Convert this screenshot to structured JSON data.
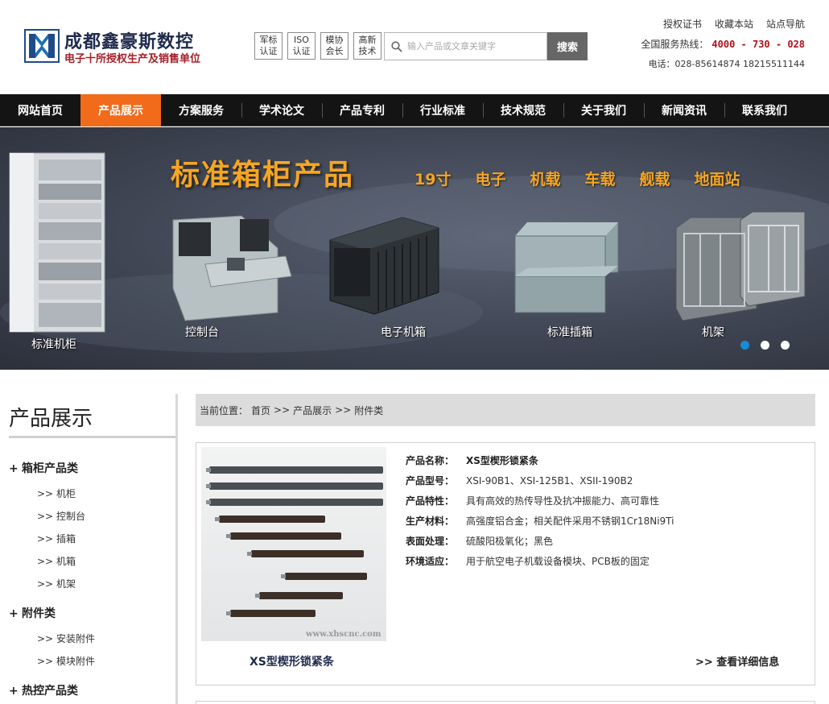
{
  "header": {
    "company_name": "成都鑫豪斯数控",
    "company_sub": "电子十所授权生产及销售单位",
    "badges": [
      {
        "line1": "军标",
        "line2": "认证"
      },
      {
        "line1": "ISO",
        "line2": "认证"
      },
      {
        "line1": "模协",
        "line2": "会长"
      },
      {
        "line1": "高新",
        "line2": "技术"
      }
    ],
    "search_placeholder": "输入产品或文章关键字",
    "search_button": "搜索",
    "top_links": [
      "授权证书",
      "收藏本站",
      "站点导航"
    ],
    "hotline_label": "全国服务热线：",
    "hotline_number": "4000 - 730 - 028",
    "phone": "电话：028-85614874 18215511144"
  },
  "nav": {
    "items": [
      "网站首页",
      "产品展示",
      "方案服务",
      "学术论文",
      "产品专利",
      "行业标准",
      "技术规范",
      "关于我们",
      "新闻资讯",
      "联系我们"
    ],
    "active_index": 1,
    "active_color": "#f26b1a"
  },
  "banner": {
    "title": "标准箱柜产品",
    "tags": [
      "19寸",
      "电子",
      "机载",
      "车载",
      "舰载",
      "地面站"
    ],
    "captions": [
      "标准机柜",
      "控制台",
      "电子机箱",
      "标准插箱",
      "机架"
    ],
    "slides": 3,
    "active_slide": 0,
    "title_color": "#f5a623"
  },
  "sidebar": {
    "title": "产品展示",
    "categories": [
      {
        "label": "箱柜产品类",
        "items": [
          "机柜",
          "控制台",
          "插箱",
          "机箱",
          "机架"
        ]
      },
      {
        "label": "附件类",
        "items": [
          "安装附件",
          "模块附件"
        ]
      },
      {
        "label": "热控产品类",
        "items": []
      }
    ]
  },
  "breadcrumb": {
    "label": "当前位置：",
    "path": [
      "首页",
      "产品展示",
      "附件类"
    ],
    "separator": ">>"
  },
  "product": {
    "caption": "XS型楔形锁紧条",
    "watermark": "www.xhscnc.com",
    "detail_link": ">> 查看详细信息",
    "specs": [
      {
        "key": "产品名称：",
        "value": "XS型楔形锁紧条"
      },
      {
        "key": "产品型号：",
        "value": "XSI-90B1、XSI-125B1、XSII-190B2"
      },
      {
        "key": "产品特性：",
        "value": "具有高效的热传导性及抗冲振能力、高可靠性"
      },
      {
        "key": "生产材料：",
        "value": "高强度铝合金；相关配件采用不锈钢1Cr18Ni9Ti"
      },
      {
        "key": "表面处理：",
        "value": "硫酸阳极氧化；黑色"
      },
      {
        "key": "环境适应：",
        "value": "用于航空电子机载设备模块、PCB板的固定"
      }
    ]
  }
}
